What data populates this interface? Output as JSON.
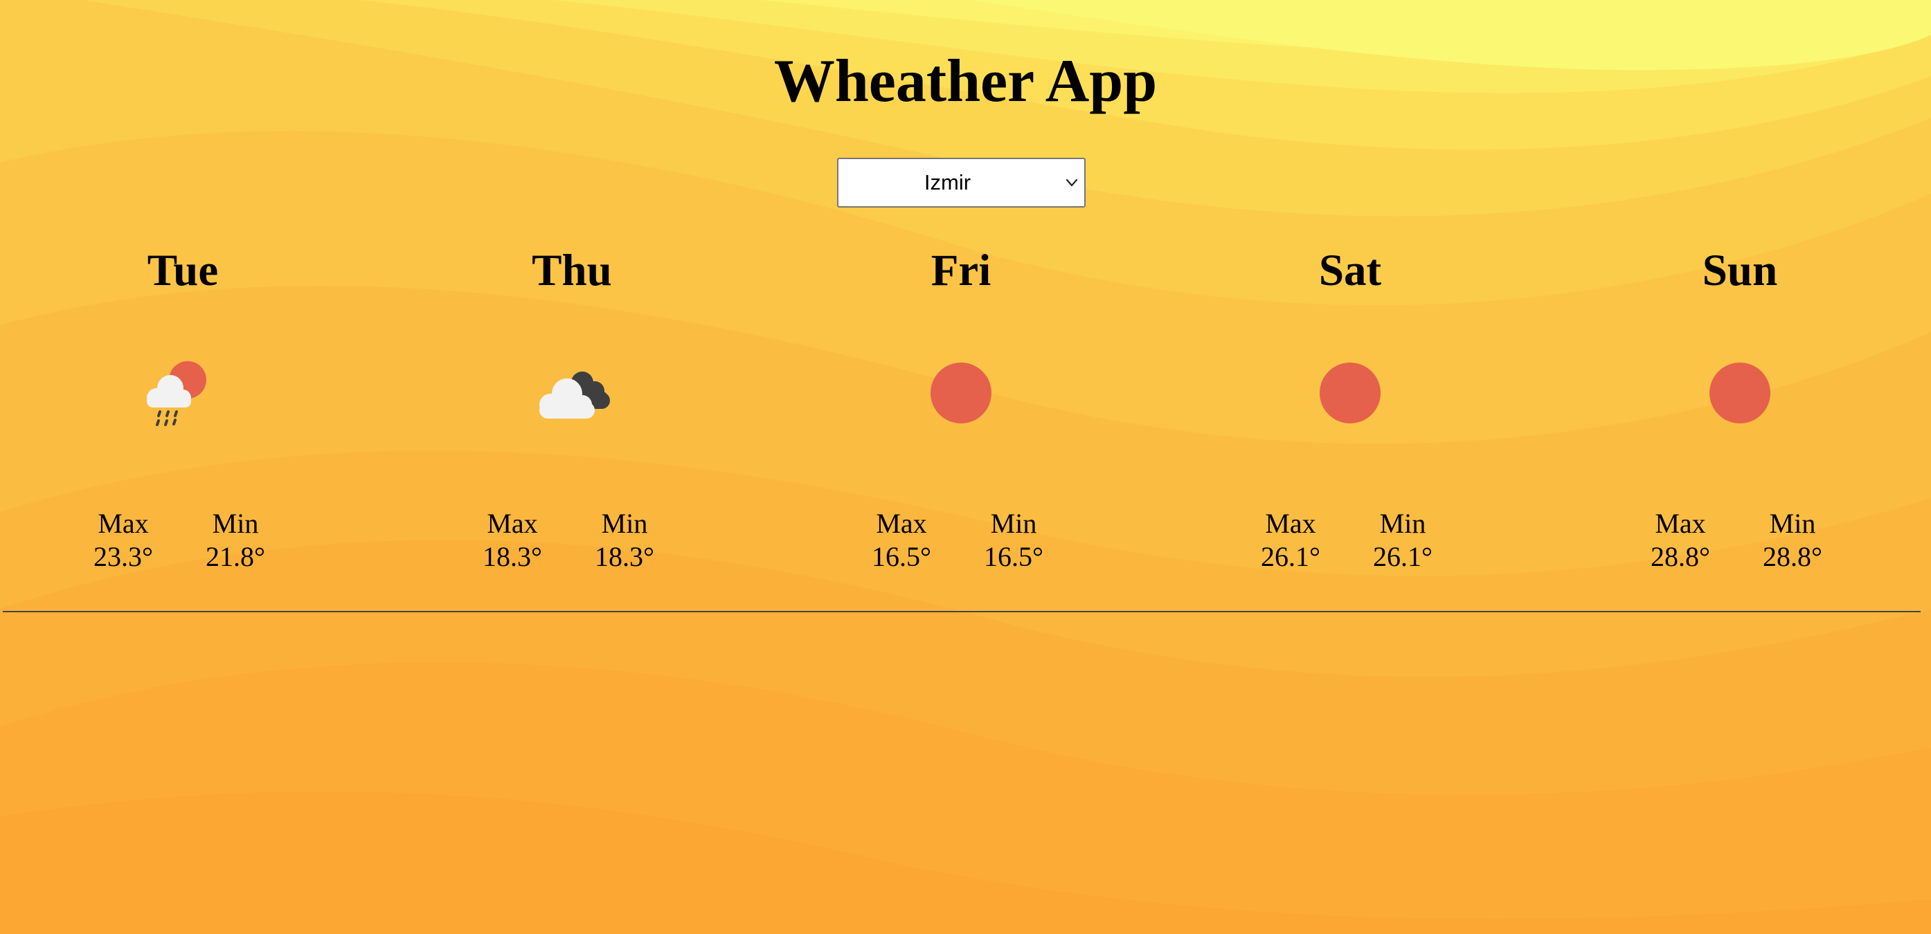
{
  "app": {
    "title": "Wheather App"
  },
  "city_select": {
    "selected": "Izmir",
    "icon": "chevron-down-icon"
  },
  "labels": {
    "max": "Max",
    "min": "Min"
  },
  "days": [
    {
      "name": "Tue",
      "icon": "rain-cloud-sun-icon",
      "max": "23.3°",
      "min": "21.8°"
    },
    {
      "name": "Thu",
      "icon": "cloudy-icon",
      "max": "18.3°",
      "min": "18.3°"
    },
    {
      "name": "Fri",
      "icon": "sun-icon",
      "max": "16.5°",
      "min": "16.5°"
    },
    {
      "name": "Sat",
      "icon": "sun-icon",
      "max": "26.1°",
      "min": "26.1°"
    },
    {
      "name": "Sun",
      "icon": "sun-icon",
      "max": "28.8°",
      "min": "28.8°"
    }
  ],
  "colors": {
    "sun": "#e5614b",
    "cloud_light": "#f2f2f2",
    "cloud_dark": "#3f3f3f",
    "bg_light": "#fbf873",
    "bg_dark": "#fca432"
  }
}
